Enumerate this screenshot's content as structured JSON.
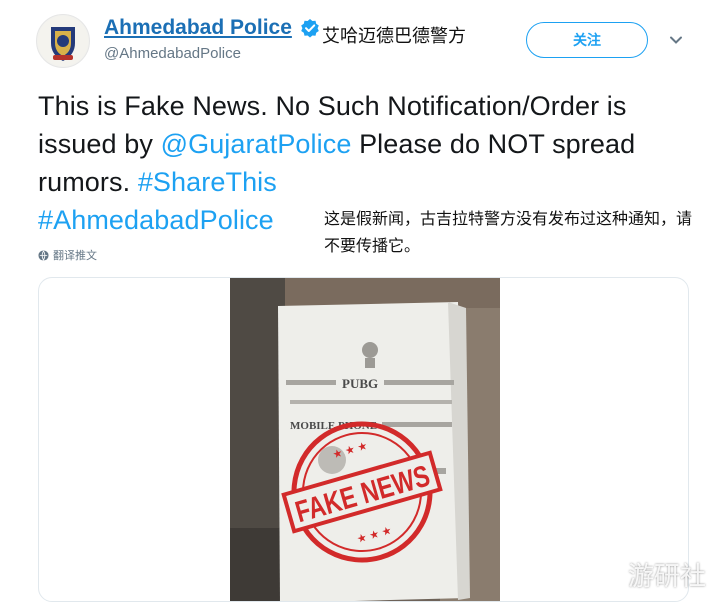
{
  "author": {
    "display_name": "Ahmedabad Police",
    "handle": "@AhmedabadPolice",
    "verified_icon": "verified-badge-icon",
    "chinese_name": "艾哈迈德巴德警方"
  },
  "follow_button": {
    "label": "关注"
  },
  "menu_icon": "chevron-down-icon",
  "tweet": {
    "text_1": "This is Fake News. No Such Notification/Order is issued by ",
    "mention": "@GujaratPolice",
    "text_2": " Please do NOT spread rumors. ",
    "hashtag_1": "#ShareThis",
    "hashtag_2": "#AhmedabadPolice"
  },
  "chinese_note": "这是假新闻，古吉拉特警方没有发布过这种通知，请不要传播它。",
  "translate_label": "翻译推文",
  "media": {
    "poster_pubg": "PUBG",
    "poster_mobile": "MOBILE PHONE",
    "stamp_text": "FAKE NEWS"
  },
  "watermark": "游研社",
  "colors": {
    "link": "#1da1f2",
    "name_link": "#1b6fb5",
    "stamp_red": "#d22a2a",
    "text": "#14171a",
    "muted": "#657786"
  }
}
